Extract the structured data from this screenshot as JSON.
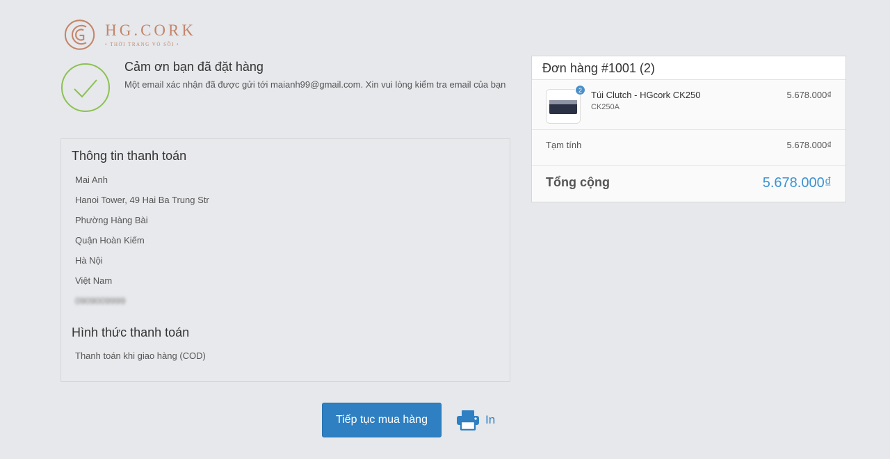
{
  "logo": {
    "name": "HG.CORK",
    "tagline": "• THỜI TRANG VỎ SỒI •"
  },
  "confirmation": {
    "title": "Cảm ơn bạn đã đặt hàng",
    "message": "Một email xác nhận đã được gửi tới maianh99@gmail.com. Xin vui lòng kiểm tra email của bạn"
  },
  "billing": {
    "title": "Thông tin thanh toán",
    "name": "Mai Anh",
    "address": "Hanoi Tower, 49 Hai Ba Trung Str",
    "ward": "Phường Hàng Bài",
    "district": "Quận Hoàn Kiếm",
    "city": "Hà Nội",
    "country": "Việt Nam",
    "phone": "0909009999"
  },
  "payment": {
    "title": "Hình thức thanh toán",
    "method": "Thanh toán khi giao hàng (COD)"
  },
  "actions": {
    "continue_label": "Tiếp tục mua hàng",
    "print_label": "In"
  },
  "order": {
    "title": "Đơn hàng #1001 (2)",
    "items": [
      {
        "name": "Túi Clutch - HGcork CK250",
        "variant": "CK250A",
        "quantity": "2",
        "price": "5.678.000₫"
      }
    ],
    "subtotal_label": "Tạm tính",
    "subtotal_value": "5.678.000₫",
    "total_label": "Tổng cộng",
    "total_value": "5.678.000₫"
  },
  "colors": {
    "accent": "#2f80c2",
    "success": "#8cc152",
    "brand": "#c4856a",
    "total": "#3a93d3"
  }
}
